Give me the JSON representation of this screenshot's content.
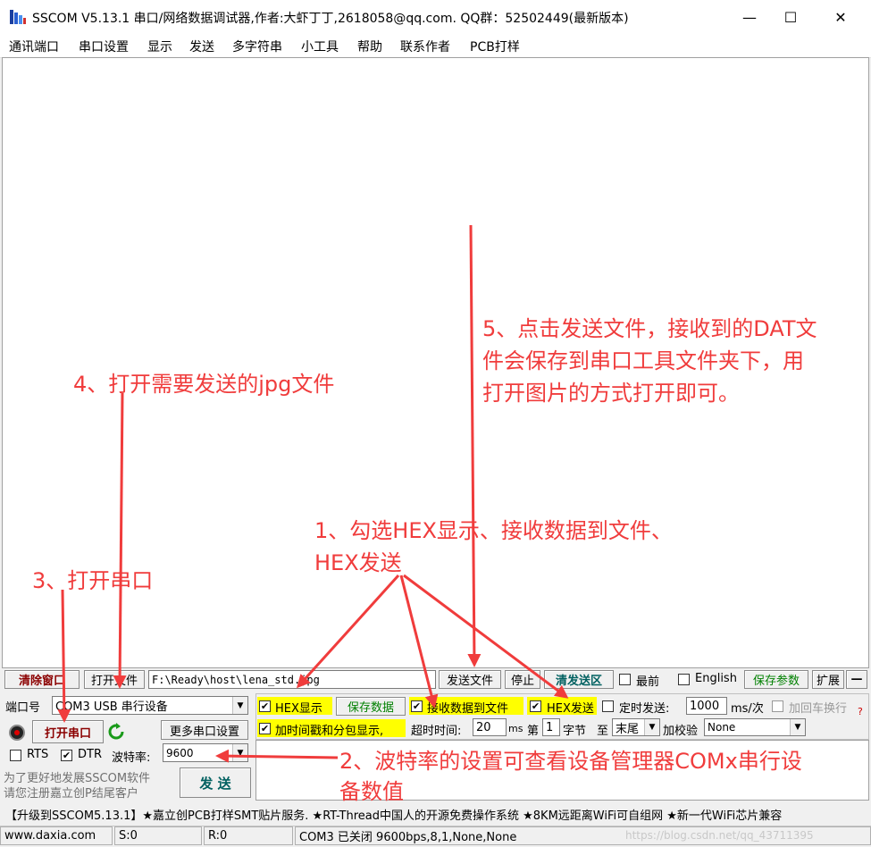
{
  "window": {
    "title": "SSCOM V5.13.1 串口/网络数据调试器,作者:大虾丁丁,2618058@qq.com. QQ群：52502449(最新版本)",
    "minimize": "—",
    "maximize": "☐",
    "close": "✕"
  },
  "menu": [
    "通讯端口",
    "串口设置",
    "显示",
    "发送",
    "多字符串",
    "小工具",
    "帮助",
    "联系作者",
    "PCB打样"
  ],
  "toolbar": {
    "clear_window": "清除窗口",
    "open_file": "打开文件",
    "file_path": "F:\\Ready\\host\\lena_std.jpg",
    "send_file": "发送文件",
    "stop": "停止",
    "clear_send": "清发送区",
    "topmost": "最前",
    "english": "English",
    "save_params": "保存参数",
    "expand": "扩展",
    "collapse": "—"
  },
  "port": {
    "port_label": "端口号",
    "port_value": "COM3 USB 串行设备",
    "more_settings": "更多串口设置",
    "open_port": "打开串口",
    "rts": "RTS",
    "dtr": "DTR",
    "baud_label": "波特率:",
    "baud_value": "9600",
    "promo_line1": "为了更好地发展SSCOM软件",
    "promo_line2": "请您注册嘉立创P结尾客户"
  },
  "options": {
    "hex_display": "HEX显示",
    "save_data": "保存数据",
    "recv_to_file": "接收数据到文件",
    "hex_send": "HEX发送",
    "timed_send": "定时发送:",
    "interval": "1000",
    "interval_unit": "ms/次",
    "add_crlf": "加回车换行",
    "timestamp": "加时间戳和分包显示,",
    "timeout_label": "超时时间:",
    "timeout": "20",
    "timeout_unit": "ms",
    "nth": "第",
    "byte_no": "1",
    "byte_label": "字节",
    "to": "至",
    "end_value": "末尾",
    "checksum_label": "加校验",
    "checksum_value": "None",
    "send": "发 送",
    "help_q": "?"
  },
  "ticker": "【升级到SSCOM5.13.1】★嘉立创PCB打样SMT贴片服务. ★RT-Thread中国人的开源免费操作系统 ★8KM远距离WiFi可自组网 ★新一代WiFi芯片兼容",
  "status": {
    "site": "www.daxia.com",
    "s": "S:0",
    "r": "R:0",
    "state": "COM3 已关闭  9600bps,8,1,None,None",
    "watermark": "https://blog.csdn.net/qq_43711395"
  },
  "annotations": {
    "a1_line1": "1、勾选HEX显示、接收数据到文件、",
    "a1_line2": "HEX发送",
    "a2_line1": "2、波特率的设置可查看设备管理器COMx串行设",
    "a2_line2": "备数值",
    "a3": "3、打开串口",
    "a4": "4、打开需要发送的jpg文件",
    "a5_line1": "5、点击发送文件，接收到的DAT文",
    "a5_line2": "件会保存到串口工具文件夹下，用",
    "a5_line3": "打开图片的方式打开即可。"
  },
  "colors": {
    "annotation": "#f03c3c",
    "highlight": "#ffff00",
    "green": "#008000",
    "darkred": "#8b0000"
  }
}
